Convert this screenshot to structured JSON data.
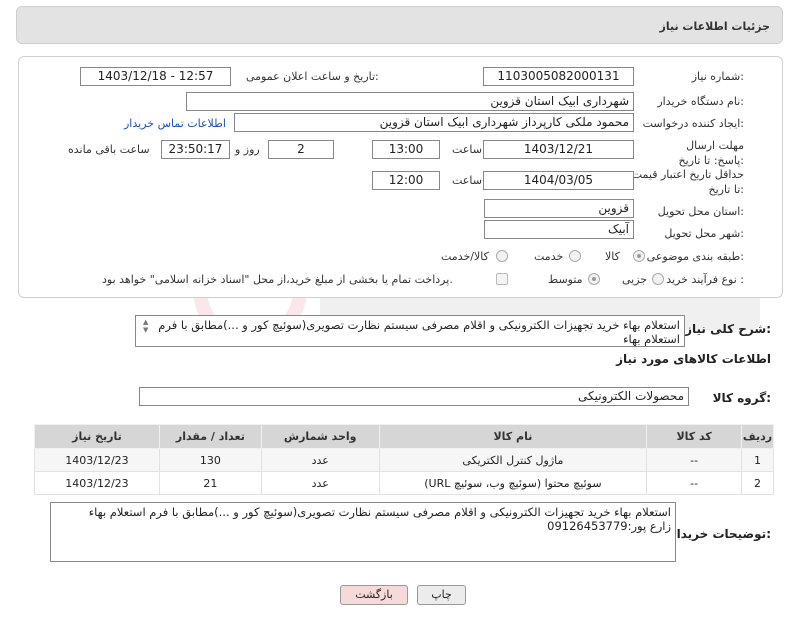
{
  "header": {
    "title": "جزئیات اطلاعات نیاز"
  },
  "need_number": {
    "label": "شماره نیاز:",
    "value": "1103005082000131"
  },
  "announce_datetime": {
    "label": "تاریخ و ساعت اعلان عمومی:",
    "value": "1403/12/18 - 12:57"
  },
  "buyer_org": {
    "label": "نام دستگاه خریدار:",
    "value": "شهرداری ابیک استان قزوین"
  },
  "requester": {
    "label": "ایجاد کننده درخواست:",
    "value": "محمود ملکی کارپرداز شهرداری ابیک استان قزوین",
    "contact_link": "اطلاعات تماس خریدار"
  },
  "reply_deadline": {
    "label": "مهلت ارسال پاسخ: تا تاریخ:",
    "date": "1403/12/21",
    "time_label": "ساعت",
    "time": "13:00",
    "days": "2",
    "days_label": "روز و",
    "remaining": "23:50:17",
    "remaining_label": "ساعت باقی مانده"
  },
  "price_validity": {
    "label": "حداقل تاریخ اعتبار قیمت: تا تاریخ:",
    "date": "1404/03/05",
    "time_label": "ساعت",
    "time": "12:00"
  },
  "delivery_province": {
    "label": "استان محل تحویل:",
    "value": "قزوین"
  },
  "delivery_city": {
    "label": "شهر محل تحویل:",
    "value": "آبیک"
  },
  "subject_category": {
    "label": "طبقه بندی موضوعی:",
    "options": [
      "کالا",
      "خدمت",
      "کالا/خدمت"
    ],
    "selected": "کالا"
  },
  "purchase_type": {
    "label": "نوع فرآیند خرید :",
    "options": [
      "جزیی",
      "متوسط"
    ],
    "selected": "متوسط",
    "payment_note": "پرداخت تمام یا بخشی از مبلغ خرید،از محل \"اسناد خزانه اسلامی\" خواهد بود."
  },
  "general_description": {
    "label": "شرح کلی نیاز:",
    "value": "استعلام بهاء خرید تجهیزات الکترونیکی و اقلام مصرفی سیستم نظارت تصویری(سوئیچ کور و ...)مطابق با فرم استعلام بهاء"
  },
  "goods_info": {
    "title": "اطلاعات کالاهای مورد نیاز"
  },
  "goods_group": {
    "label": "گروه کالا:",
    "value": "محصولات الکترونیکی"
  },
  "table": {
    "headers": [
      "ردیف",
      "کد کالا",
      "نام کالا",
      "واحد شمارش",
      "تعداد / مقدار",
      "تاریخ نیاز"
    ],
    "rows": [
      [
        "1",
        "--",
        "ماژول کنترل الکتریکی",
        "عدد",
        "130",
        "1403/12/23"
      ],
      [
        "2",
        "--",
        "سوئیچ محتوا (سوئیچ وب، سوئیچ URL)",
        "عدد",
        "21",
        "1403/12/23"
      ]
    ]
  },
  "buyer_notes": {
    "label": "توضیحات خریدار:",
    "line1": "استعلام بهاء خرید تجهیزات الکترونیکی و اقلام مصرفی سیستم نظارت تصویری(سوئیچ کور و ...)مطابق با فرم استعلام بهاء",
    "line2": "زارع پور:09126453779"
  },
  "buttons": {
    "print": "چاپ",
    "back": "بازگشت"
  }
}
